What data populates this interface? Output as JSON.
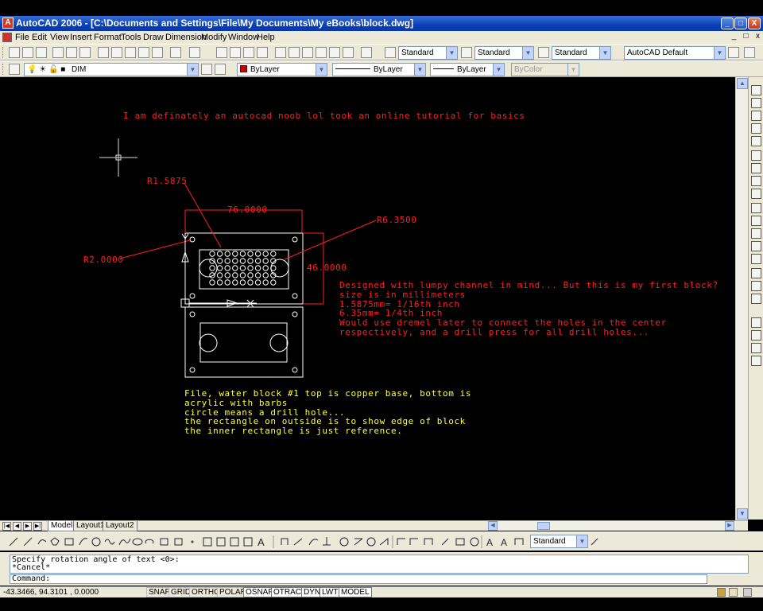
{
  "window": {
    "title": "AutoCAD 2006 - [C:\\Documents and Settings\\File\\My Documents\\My eBooks\\block.dwg]",
    "app_icon": "A",
    "minimize": "_",
    "maximize": "□",
    "close": "X"
  },
  "menu": {
    "items": [
      "File",
      "Edit",
      "View",
      "Insert",
      "Format",
      "Tools",
      "Draw",
      "Dimension",
      "Modify",
      "Window",
      "Help"
    ],
    "doc_min": "_",
    "doc_restore": "□",
    "doc_close": "x"
  },
  "toolbar1": {
    "text_style": "Standard",
    "dim_style": "Standard",
    "table_style": "Standard",
    "workspace": "AutoCAD Default"
  },
  "toolbar2": {
    "layer": "DIM",
    "color": "ByLayer",
    "linetype": "ByLayer",
    "lineweight": "ByLayer",
    "plotstyle": "ByColor"
  },
  "drawing": {
    "note_top": "I am definately an autocad noob lol took an online tutorial for basics",
    "dim_r1": "R1.5875",
    "dim_76": "76.0000",
    "dim_r6": "R6.3500",
    "dim_r2": "R2.0000",
    "dim_46": "46.0000",
    "note_right": "Designed with lumpy channel in mind... But this is my first block?\nsize is in millimeters\n1.5875mm= 1/16th inch\n6.35mm= 1/4th inch\nWould use dremel later to connect the holes in the center\nrespectively, and a drill press for all drill holes...",
    "note_bottom": "File, water block #1 top is copper base, bottom is\nacrylic with barbs\ncircle means a drill hole...\nthe rectangle on outside is to show edge of block\nthe inner rectangle is just reference.",
    "ucs_y": "Y",
    "ucs_x": "X"
  },
  "tabs": {
    "model": "Model",
    "layout1": "Layout1",
    "layout2": "Layout2"
  },
  "bottom_toolbar": {
    "text_style": "Standard"
  },
  "command": {
    "history": "Specify rotation angle of text <0>:\n*Cancel*",
    "prompt": "Command:"
  },
  "status": {
    "coords": "-43.3466, 94.3101 , 0.0000",
    "buttons": [
      "SNAP",
      "GRID",
      "ORTHO",
      "POLAR",
      "OSNAP",
      "OTRACK",
      "DYN",
      "LWT",
      "MODEL"
    ],
    "active": [
      "OSNAP",
      "OTRACK",
      "DYN",
      "LWT",
      "MODEL"
    ]
  },
  "colors": {
    "title_blue": "#0a40b8",
    "drawing_bg": "#000000",
    "red_text": "#ff1e1e",
    "yellow_text": "#ffff3c",
    "white_geometry": "#ffffff"
  }
}
